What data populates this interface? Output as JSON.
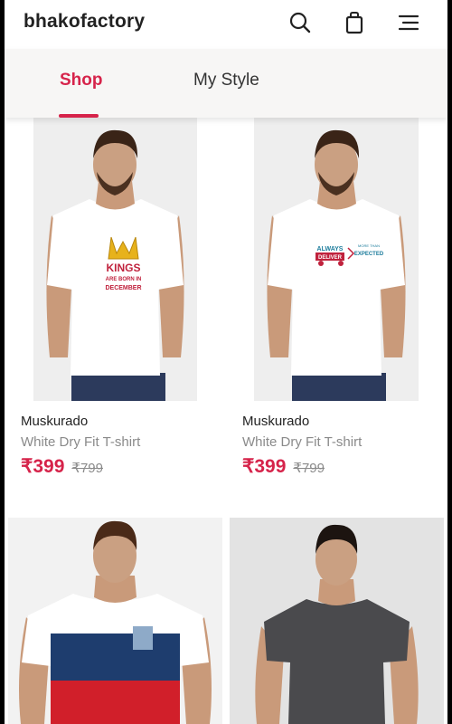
{
  "header": {
    "brand": "bhakofactory",
    "icons": [
      "search-icon",
      "shopping-bag-icon",
      "menu-icon"
    ]
  },
  "tabs": [
    {
      "label": "Shop",
      "active": true
    },
    {
      "label": "My Style",
      "active": false
    }
  ],
  "products": [
    {
      "brand": "Muskurado",
      "name": "White Dry Fit T-shirt",
      "price": "₹399",
      "mrp": "₹799",
      "print_text": [
        "KINGS",
        "ARE BORN IN",
        "DECEMBER"
      ]
    },
    {
      "brand": "Muskurado",
      "name": "White Dry Fit T-shirt",
      "price": "₹399",
      "mrp": "₹799",
      "print_text": [
        "ALWAYS",
        "DELIVER",
        "MORE THAN",
        "EXPECTED"
      ]
    },
    {
      "brand": "",
      "name": "",
      "price": "",
      "mrp": ""
    },
    {
      "brand": "",
      "name": "",
      "price": "",
      "mrp": ""
    }
  ],
  "colors": {
    "accent": "#d6234a",
    "tab_bar": "#f7f6f5",
    "muted_text": "#8a8a8a"
  }
}
